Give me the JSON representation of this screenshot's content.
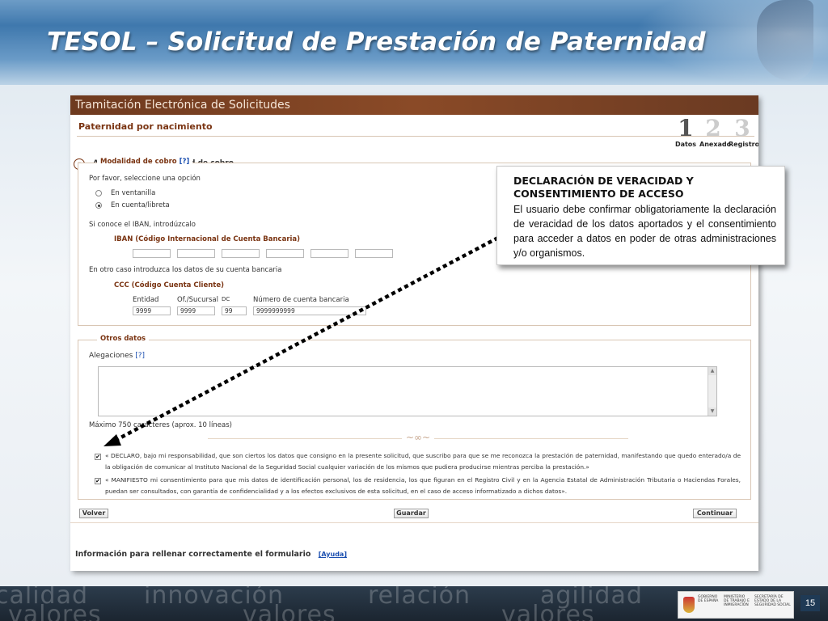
{
  "slide": {
    "title": "TESOL – Solicitud de Prestación de Paternidad",
    "page_number": "15"
  },
  "app": {
    "banner": "Tramitación Electrónica de Solicitudes",
    "section_title": "Paternidad por nacimiento",
    "accordion_icon": "chevron-down-icon",
    "accordion_label": "Alegaciones y modalidad de cobro",
    "steps": [
      {
        "number": "1",
        "label": "Datos",
        "active": true
      },
      {
        "number": "2",
        "label": "Anexado",
        "active": false
      },
      {
        "number": "3",
        "label": "Registro",
        "active": false
      }
    ]
  },
  "payment": {
    "legend": "Modalidad de cobro",
    "help": "[?]",
    "prompt": "Por favor, seleccione una opción",
    "options": [
      {
        "label": "En ventanilla",
        "selected": false
      },
      {
        "label": "En cuenta/libreta",
        "selected": true
      }
    ],
    "iban_prompt": "Si conoce el IBAN, introdúzcalo",
    "iban_label": "IBAN (Código Internacional de Cuenta Bancaria)",
    "iban_values": [
      "",
      "",
      "",
      "",
      "",
      ""
    ],
    "other_prompt": "En otro caso introduzca los datos de su cuenta bancaria",
    "ccc_label": "CCC (Código Cuenta Cliente)",
    "ccc_fields": [
      {
        "label": "Entidad",
        "value": "9999"
      },
      {
        "label": "Of./Sucursal",
        "value": "9999"
      },
      {
        "label": "DC",
        "value": "99"
      },
      {
        "label": "Número de cuenta bancaria",
        "value": "9999999999"
      }
    ]
  },
  "other": {
    "legend": "Otros datos",
    "alegaciones_label": "Alegaciones",
    "help": "[?]",
    "alegaciones_value": "",
    "max_note": "Máximo 750 caracteres (aprox. 10 líneas)",
    "ornament": "~∞~"
  },
  "declarations": [
    {
      "checked": true,
      "check_mark": "✔",
      "text": "« DECLARO, bajo mi responsabilidad, que son ciertos los datos que consigno en la presente solicitud, que suscribo para que se me reconozca la prestación de paternidad, manifestando que quedo enterado/a de la obligación de comunicar al Instituto Nacional de la Seguridad Social cualquier variación de los mismos que pudiera producirse mientras perciba la prestación.»"
    },
    {
      "checked": true,
      "check_mark": "✔",
      "text": "« MANIFIESTO mi consentimiento para que mis datos de identificación personal, los de residencia, los que figuran en el Registro Civil y en la Agencia Estatal de Administración Tributaria o Haciendas Forales, puedan ser consultados, con garantía de confidencialidad y a los efectos exclusivos de esta solicitud, en el caso de acceso informatizado a dichos datos»."
    }
  ],
  "buttons": {
    "back": "Volver",
    "save": "Guardar",
    "next": "Continuar"
  },
  "info": {
    "text": "Información para rellenar correctamente el formulario",
    "help_link": "[Ayuda]"
  },
  "callout": {
    "title": "DECLARACIÓN DE VERACIDAD Y CONSENTIMIENTO DE ACCESO",
    "body": "El usuario debe confirmar obligatoriamente la declaración de veracidad de los datos aportados y el consentimiento para acceder a datos en poder de otras administraciones y/o organismos."
  },
  "footer": {
    "words": [
      "calidad",
      "innovación",
      "relación",
      "agilidad",
      "valores",
      "valores",
      "valores"
    ],
    "logos": [
      "GOBIERNO DE ESPAÑA",
      "MINISTERIO DE TRABAJO E INMIGRACIÓN",
      "SECRETARÍA DE ESTADO DE LA SEGURIDAD SOCIAL"
    ]
  }
}
